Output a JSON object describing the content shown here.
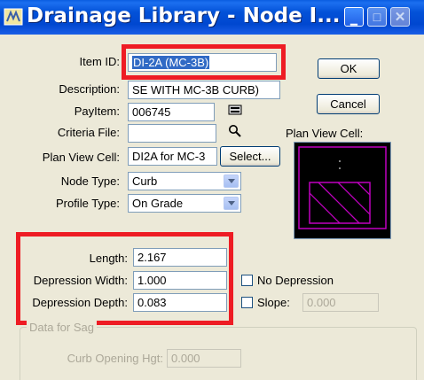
{
  "window": {
    "title": "Drainage Library - Node I..."
  },
  "fields": {
    "item_id": {
      "label": "Item ID:",
      "value": "DI-2A (MC-3B)"
    },
    "description": {
      "label": "Description:",
      "value": "SE WITH MC-3B CURB)"
    },
    "pay_item": {
      "label": "PayItem:",
      "value": "006745"
    },
    "criteria_file": {
      "label": "Criteria File:",
      "value": ""
    },
    "plan_view_cell": {
      "label": "Plan View Cell:",
      "value": "DI2A for MC-3"
    },
    "node_type": {
      "label": "Node Type:",
      "value": "Curb"
    },
    "profile_type": {
      "label": "Profile Type:",
      "value": "On Grade"
    },
    "length": {
      "label": "Length:",
      "value": "2.167"
    },
    "depression_width": {
      "label": "Depression Width:",
      "value": "1.000"
    },
    "depression_depth": {
      "label": "Depression Depth:",
      "value": "0.083"
    },
    "slope": {
      "label": "Slope:",
      "value": "0.000"
    }
  },
  "buttons": {
    "ok": "OK",
    "cancel": "Cancel",
    "select": "Select..."
  },
  "preview": {
    "label": "Plan View Cell:"
  },
  "checkboxes": {
    "no_depression": {
      "label": "No Depression",
      "checked": false
    },
    "slope": {
      "checked": false
    }
  },
  "sag": {
    "title": "Data for Sag",
    "curb_opening_label": "Curb Opening Hgt:",
    "curb_opening_value": "0.000"
  },
  "icons": {
    "app": "drainage-app-icon",
    "payitem": "keyboard-icon",
    "criteria": "magnifier-icon"
  },
  "colors": {
    "highlight": "#ee1c24",
    "preview_cell": "#c000c0",
    "titlebar": "#0352d8"
  }
}
